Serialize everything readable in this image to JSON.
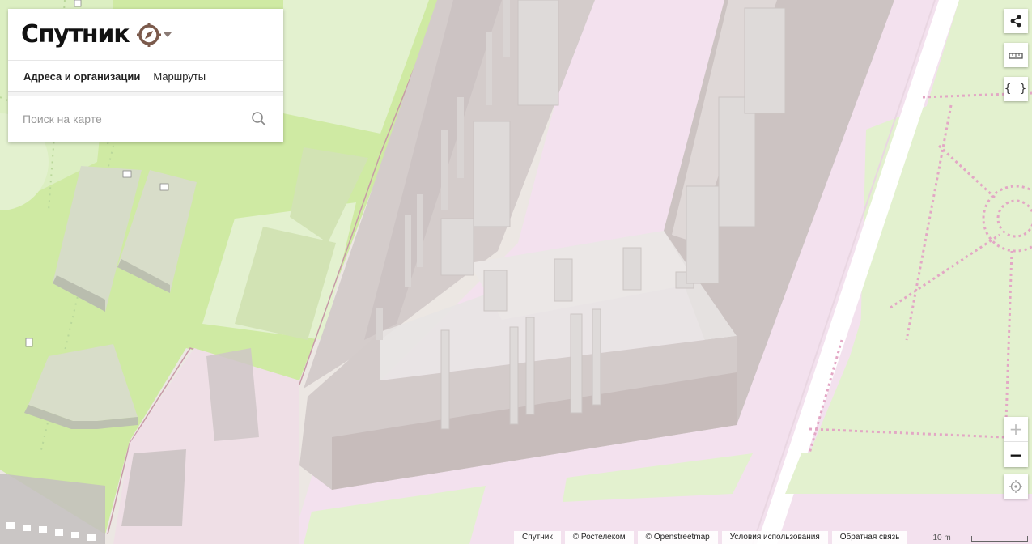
{
  "brand": {
    "name": "Спутник",
    "logo_icon": "compass-icon",
    "menu_icon": "chevron-down-icon",
    "logo_color": "#7b5a4c"
  },
  "tabs": [
    {
      "label": "Адреса и организации",
      "active": true
    },
    {
      "label": "Маршруты",
      "active": false
    }
  ],
  "search": {
    "placeholder": "Поиск на карте",
    "value": "",
    "icon": "search-icon"
  },
  "tools": {
    "share_icon": "share-icon",
    "ruler_icon": "ruler-icon",
    "code_label": "{ }",
    "zoom_in_label": "+",
    "zoom_out_label": "−",
    "locate_icon": "locate-icon"
  },
  "attribution": {
    "links": [
      "Спутник",
      "© Ростелеком",
      "© Openstreetmap",
      "Условия использования",
      "Обратная связь"
    ],
    "scale_label": "10 m"
  },
  "map_colors": {
    "grass": "#cfeaa3",
    "park": "#e3f1cf",
    "pedestrian": "#f3e1ee",
    "land": "#f0eaea",
    "building": "#d2cac8",
    "footpath": "#e3a7c5"
  }
}
